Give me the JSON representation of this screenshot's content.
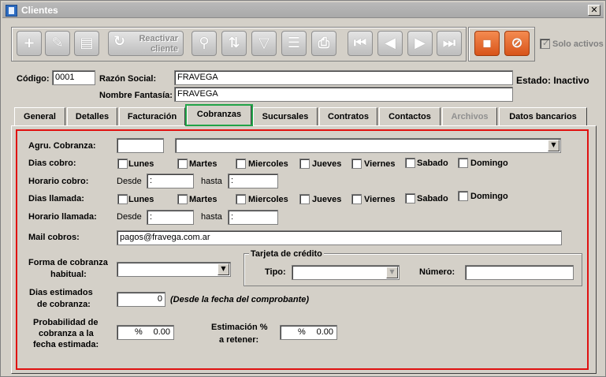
{
  "window": {
    "title": "Clientes",
    "close_glyph": "✕"
  },
  "toolbar": {
    "reactivar_label": "Reactivar\ncliente",
    "solo_activos_label": "Solo activos",
    "buttons": [
      "plus-icon",
      "pencil-icon",
      "document-icon",
      "reactivate-icon",
      "search-icon",
      "sort-icon",
      "filter-icon",
      "notes-icon",
      "print-icon",
      "first-icon",
      "prev-icon",
      "next-icon",
      "last-icon",
      "save-icon",
      "cancel-icon"
    ]
  },
  "header": {
    "codigo_label": "Código:",
    "codigo_value": "0001",
    "razon_label": "Razón Social:",
    "razon_value": "FRAVEGA",
    "fantasia_label": "Nombre Fantasía:",
    "fantasia_value": "FRAVEGA",
    "estado": "Estado: Inactivo"
  },
  "tabs": [
    {
      "label": "General"
    },
    {
      "label": "Detalles"
    },
    {
      "label": "Facturación"
    },
    {
      "label": "Cobranzas"
    },
    {
      "label": "Sucursales"
    },
    {
      "label": "Contratos"
    },
    {
      "label": "Contactos"
    },
    {
      "label": "Archivos"
    },
    {
      "label": "Datos bancarios"
    }
  ],
  "cobranzas": {
    "agru_label": "Agru. Cobranza:",
    "agru_code": "",
    "agru_value": "",
    "dias_cobro_label": "Dias cobro:",
    "horario_cobro_label": "Horario cobro:",
    "dias_llamada_label": "Dias llamada:",
    "horario_llamada_label": "Horario llamada:",
    "desde_label": "Desde",
    "hasta_label": "hasta",
    "time_placeholder": ":",
    "days": [
      "Lunes",
      "Martes",
      "Miercoles",
      "Jueves",
      "Viernes",
      "Sabado",
      "Domingo"
    ],
    "mail_label": "Mail cobros:",
    "mail_value": "pagos@fravega.com.ar",
    "forma_label_1": "Forma de cobranza",
    "forma_label_2": "habitual:",
    "forma_value": "",
    "tarjeta_title": "Tarjeta de crédito",
    "tipo_label": "Tipo:",
    "tipo_value": "",
    "numero_label": "Número:",
    "numero_value": "",
    "dias_est_label_1": "Dias estimados",
    "dias_est_label_2": "de cobranza:",
    "dias_est_value": "0",
    "dias_est_note": "(Desde la fecha del comprobante)",
    "prob_label_1": "Probabilidad de",
    "prob_label_2": "cobranza a la",
    "prob_label_3": "fecha estimada:",
    "prob_pct": "%",
    "prob_value": "0.00",
    "est_label_1": "Estimación %",
    "est_label_2": "a retener:",
    "est_pct": "%",
    "est_value": "0.00"
  },
  "colors": {
    "tab_highlight": "#21a348",
    "panel_highlight": "#e01010",
    "orange_button": "#e06a2c"
  }
}
